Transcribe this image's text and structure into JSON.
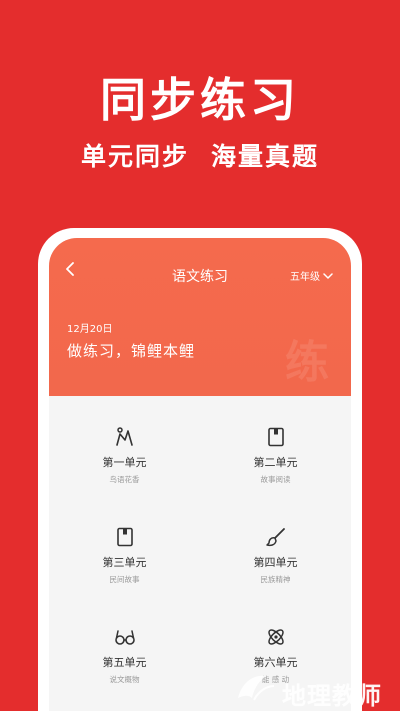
{
  "hero": {
    "title": "同步练习",
    "subtitle_left": "单元同步",
    "subtitle_right": "海量真题"
  },
  "app": {
    "nav_title": "语文练习",
    "grade": "五年级",
    "date": "12月20日",
    "slogan": "做练习，锦鲤本鲤",
    "watermark_char": "练"
  },
  "units": [
    {
      "name": "第一单元",
      "sub": "鸟语花香",
      "icon": "figure-icon"
    },
    {
      "name": "第二单元",
      "sub": "故事阅读",
      "icon": "book-icon"
    },
    {
      "name": "第三单元",
      "sub": "民间故事",
      "icon": "book-icon"
    },
    {
      "name": "第四单元",
      "sub": "民族精神",
      "icon": "brush-icon"
    },
    {
      "name": "第五单元",
      "sub": "说文概物",
      "icon": "glasses-icon"
    },
    {
      "name": "第六单元",
      "sub": "能 感 动",
      "icon": "atom-icon"
    }
  ],
  "site_watermark": "地理教师",
  "colors": {
    "background": "#e42d2d",
    "header": "#f56a4d",
    "panel": "#f5f5f5"
  }
}
